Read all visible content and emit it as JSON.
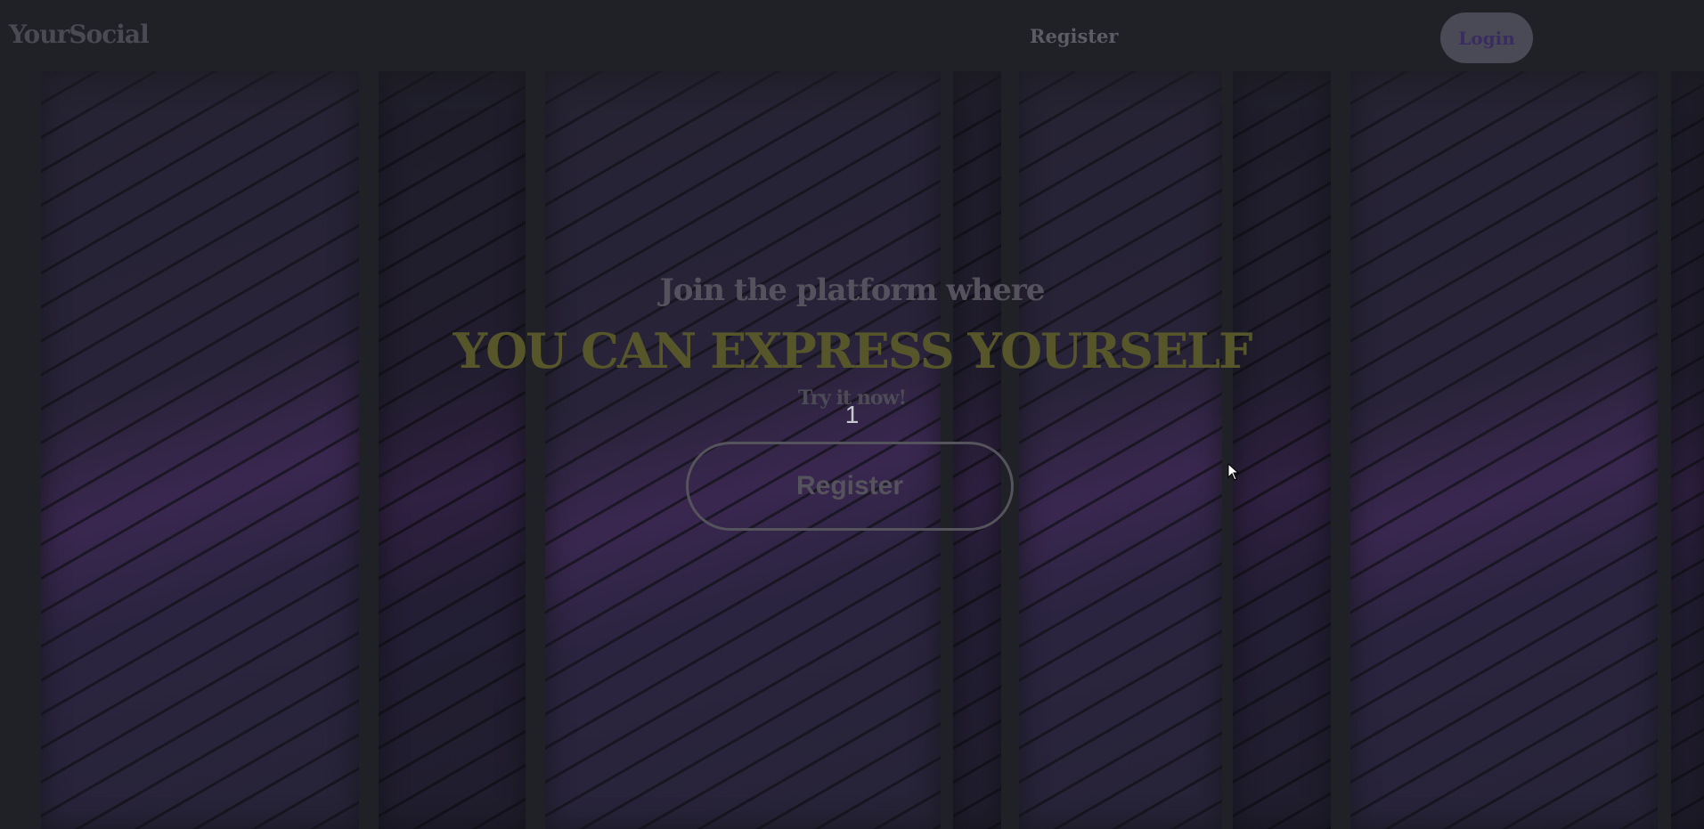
{
  "navbar": {
    "logo": "YourSocial",
    "register_label": "Register",
    "login_label": "Login"
  },
  "hero": {
    "subtitle": "Join the platform where",
    "title": "YOU CAN EXPRESS YOURSELF",
    "tagline": "Try it now!",
    "counter": "1",
    "register_label": "Register"
  },
  "colors": {
    "background": "#202027",
    "accent_title": "#56562a",
    "panel_purple": "#3a2750",
    "login_button": "#4a4a56"
  }
}
